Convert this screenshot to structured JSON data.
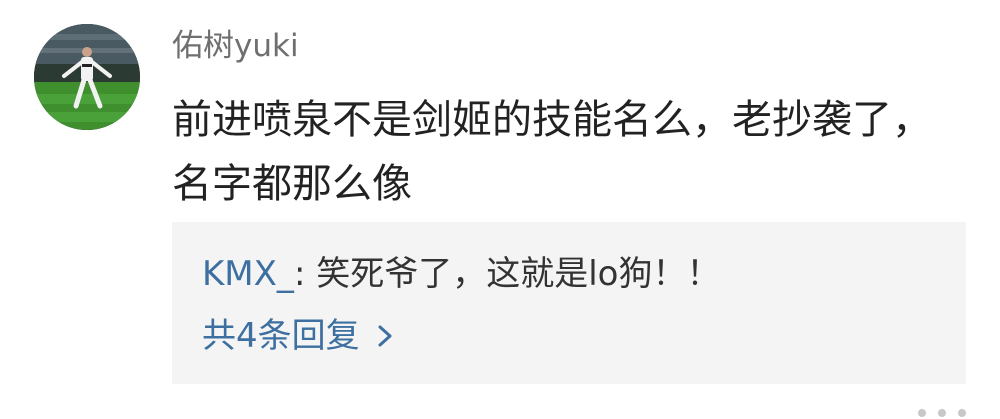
{
  "comment": {
    "username": "佑树yuki",
    "text_lines": [
      "前进喷泉不是剑姬的技能名么，老抄袭了，",
      "名字都那么像"
    ]
  },
  "reply": {
    "author": "KMX_",
    "separator": ":",
    "text": " 笑死爷了，这就是lo狗！！",
    "more_replies_label": "共4条回复"
  },
  "icons": {
    "avatar": "avatar-soccer-player-photo",
    "chevron": "chevron-right-icon"
  },
  "colors": {
    "link": "#3d6fa0",
    "username": "#6f6f6f",
    "text": "#222222",
    "reply_bg": "#f4f4f4"
  }
}
